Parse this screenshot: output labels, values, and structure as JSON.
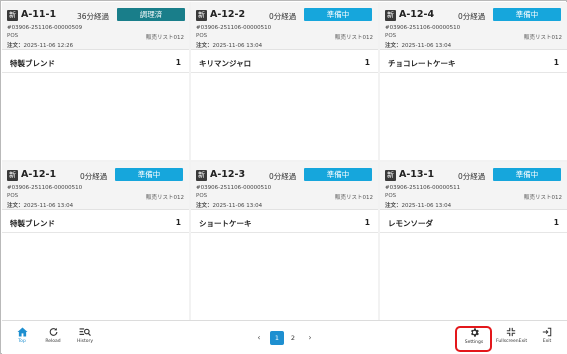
{
  "cards": [
    {
      "badge": "新",
      "table": "A-11-1",
      "elapsed": "36分経過",
      "status": "調理済",
      "status_type": "cooked",
      "order_no": "#03906-251106-00000509",
      "channel": "POS",
      "list": "販売リスト012",
      "order_label": "注文：",
      "order_time": "2025-11-06 12:26",
      "item_name": "特製ブレンド",
      "item_qty": "1"
    },
    {
      "badge": "新",
      "table": "A-12-2",
      "elapsed": "0分経過",
      "status": "準備中",
      "status_type": "prep",
      "order_no": "#03906-251106-00000510",
      "channel": "POS",
      "list": "販売リスト012",
      "order_label": "注文：",
      "order_time": "2025-11-06 13:04",
      "item_name": "キリマンジャロ",
      "item_qty": "1"
    },
    {
      "badge": "新",
      "table": "A-12-4",
      "elapsed": "0分経過",
      "status": "準備中",
      "status_type": "prep",
      "order_no": "#03906-251106-00000510",
      "channel": "POS",
      "list": "販売リスト012",
      "order_label": "注文：",
      "order_time": "2025-11-06 13:04",
      "item_name": "チョコレートケーキ",
      "item_qty": "1"
    },
    {
      "badge": "新",
      "table": "A-12-1",
      "elapsed": "0分経過",
      "status": "準備中",
      "status_type": "prep",
      "order_no": "#03906-251106-00000510",
      "channel": "POS",
      "list": "販売リスト012",
      "order_label": "注文：",
      "order_time": "2025-11-06 13:04",
      "item_name": "特製ブレンド",
      "item_qty": "1"
    },
    {
      "badge": "新",
      "table": "A-12-3",
      "elapsed": "0分経過",
      "status": "準備中",
      "status_type": "prep",
      "order_no": "#03906-251106-00000510",
      "channel": "POS",
      "list": "販売リスト012",
      "order_label": "注文：",
      "order_time": "2025-11-06 13:04",
      "item_name": "ショートケーキ",
      "item_qty": "1"
    },
    {
      "badge": "新",
      "table": "A-13-1",
      "elapsed": "0分経過",
      "status": "準備中",
      "status_type": "prep",
      "order_no": "#03906-251106-00000511",
      "channel": "POS",
      "list": "販売リスト012",
      "order_label": "注文：",
      "order_time": "2025-11-06 13:04",
      "item_name": "レモンソーダ",
      "item_qty": "1"
    }
  ],
  "toolbar": {
    "top_label": "Top",
    "reload_label": "Reload",
    "history_label": "History",
    "settings_label": "Settings",
    "fullscreen_label": "FullscreenExit",
    "exit_label": "Exit"
  },
  "pager": {
    "prev": "‹",
    "next": "›",
    "page_1": "1",
    "page_2": "2"
  },
  "colors": {
    "status_prep": "#16a6dc",
    "status_cooked": "#197e8a",
    "accent": "#1e8fd0",
    "highlight": "#e3171b"
  }
}
